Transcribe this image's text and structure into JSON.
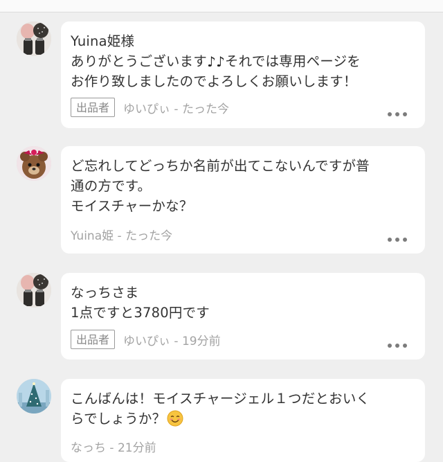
{
  "thread": {
    "comments": [
      {
        "message": "Yuina姫様\nありがとうございます🎶それでは専用ページを\nお作り致しましたのでよろしくお願いします！",
        "message_parts": [
          "Yuina姫様\nありがとうございます",
          "♪♪",
          "それでは専用ページを\nお作り致しましたのでよろしくお願いします！"
        ],
        "seller_badge": "出品者",
        "author_time": "ゆいぴぃ - たった今",
        "avatar_icon": "user-avatar-icon"
      },
      {
        "message": "ど忘れしてどっちか名前が出てこないんですが普\n通の方です。\nモイスチャーかな？",
        "seller_badge": "",
        "author_time": "Yuina姫 - たった今",
        "avatar_icon": "bear-avatar-icon"
      },
      {
        "message": "なっちさま\n1点ですと3780円です",
        "seller_badge": "出品者",
        "author_time": "ゆいぴぃ - 19分前",
        "avatar_icon": "user-avatar-icon"
      },
      {
        "message": "こんばんは！モイスチャージェル１つだとおいく\nらでしょうか？",
        "emoji": "☺️",
        "seller_badge": "",
        "author_time": "なっち - 21分前",
        "avatar_icon": "tree-avatar-icon"
      }
    ]
  },
  "colors": {
    "background": "#efefef",
    "bubble": "#ffffff",
    "text": "#333333",
    "meta": "#a3a3a3",
    "badge_border": "#999999"
  }
}
